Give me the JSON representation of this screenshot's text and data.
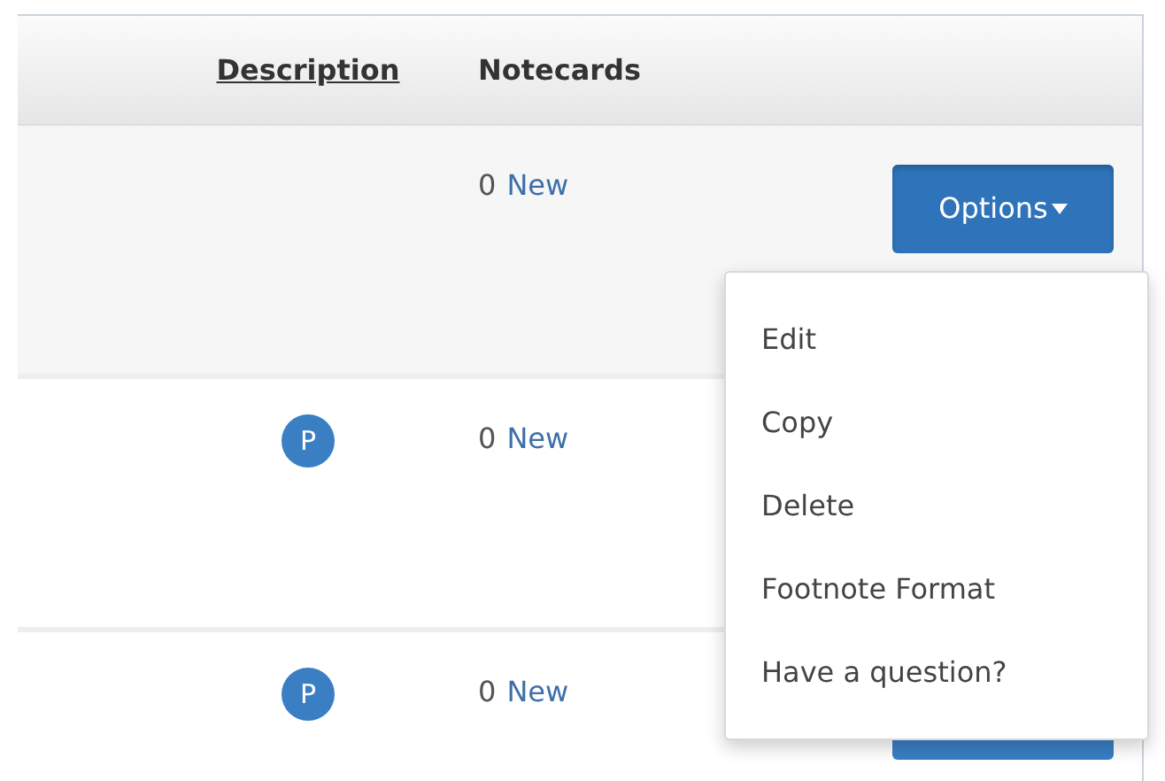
{
  "table": {
    "columns": [
      {
        "label": "Description",
        "link": true
      },
      {
        "label": "Notecards",
        "link": false
      }
    ],
    "rows": [
      {
        "notecards_count": "0",
        "notecards_link": "New",
        "options": {
          "label": "Options",
          "expanded": true,
          "menu": [
            "Edit",
            "Copy",
            "Delete",
            "Footnote Format",
            "Have a question?"
          ]
        }
      },
      {
        "badge": "P",
        "notecards_count": "0",
        "notecards_link": "New"
      },
      {
        "badge": "P",
        "notecards_count": "0",
        "notecards_link": "New",
        "options": {
          "expanded": false
        }
      }
    ]
  }
}
